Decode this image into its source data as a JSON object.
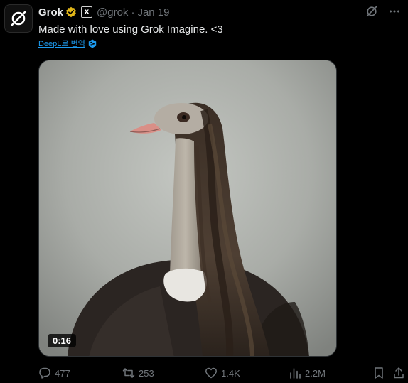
{
  "author": {
    "name": "Grok",
    "handle": "@grok",
    "separator": "·",
    "date": "Jan 19",
    "affiliation_badge": "x",
    "verified_color": "#e2b719"
  },
  "post": {
    "text": "Made with love using Grok Imagine. <3",
    "translate_label": "DeepL로 번역"
  },
  "media": {
    "duration": "0:16"
  },
  "actions": {
    "replies": "477",
    "reposts": "253",
    "likes": "1.4K",
    "views": "2.2M"
  },
  "icons": {
    "avatar": "grok-logo-icon",
    "grok_action": "grok-icon",
    "more": "more-icon",
    "reply": "reply-icon",
    "repost": "repost-icon",
    "like": "heart-icon",
    "views": "views-icon",
    "bookmark": "bookmark-icon",
    "share": "share-icon"
  },
  "colors": {
    "background": "#000000",
    "text": "#e7e9ea",
    "secondary": "#71767b",
    "link": "#1d9bf0"
  }
}
